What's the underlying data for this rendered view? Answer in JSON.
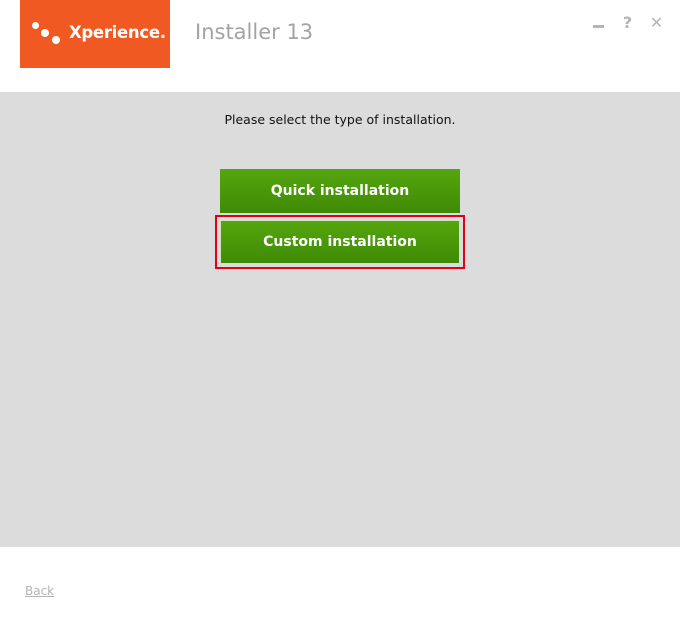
{
  "brand": {
    "logo_text": "Xperience.",
    "color": "#f05a22"
  },
  "app": {
    "title": "Installer 13"
  },
  "window_controls": {
    "minimize_icon": "minimize-icon",
    "help_label": "?",
    "close_label": "✕"
  },
  "main": {
    "prompt": "Please select the type of installation.",
    "quick_label": "Quick installation",
    "custom_label": "Custom installation",
    "button_color": "#4a9a0a",
    "highlight_color": "#e0001a"
  },
  "footer": {
    "back_label": "Back"
  }
}
